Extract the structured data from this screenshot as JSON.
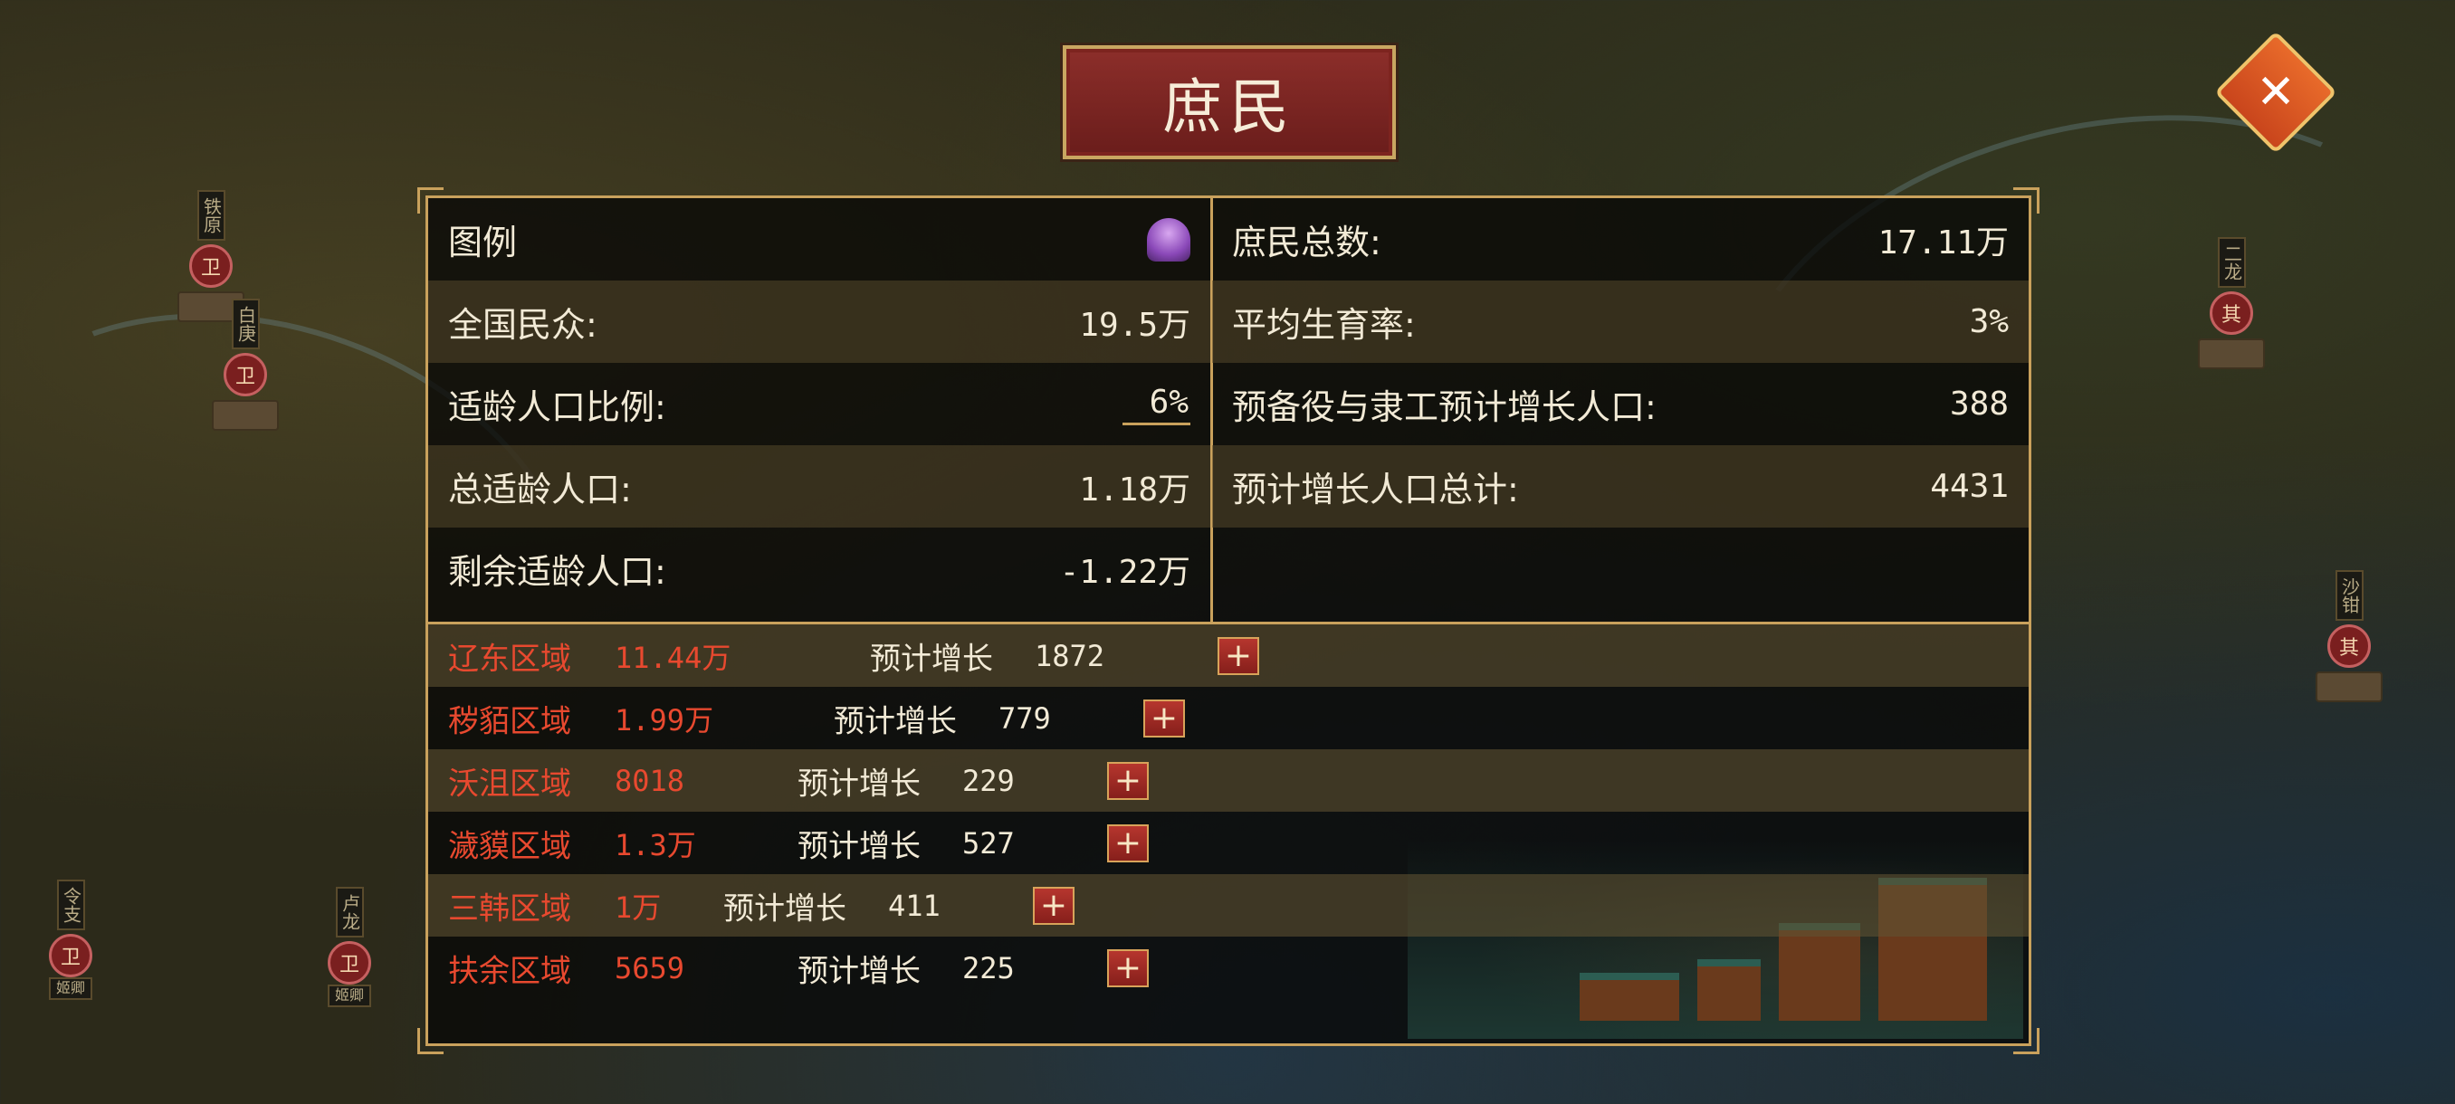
{
  "title": "庶民",
  "map_markers": [
    {
      "name": "铁原",
      "seal": "卫"
    },
    {
      "name": "白庚",
      "seal": "卫"
    },
    {
      "name": "令支",
      "seal": "卫",
      "flag": "姬卿"
    },
    {
      "name": "卢龙",
      "seal": "卫",
      "flag": "姬卿"
    },
    {
      "name": "二龙",
      "seal": "其"
    },
    {
      "name": "沙钳",
      "seal": "其"
    }
  ],
  "stats": {
    "legend_label": "图例",
    "legend_icon": "population-figures-icon",
    "national_population_label": "全国民众:",
    "national_population_value": "19.5万",
    "working_age_ratio_label": "适龄人口比例:",
    "working_age_ratio_value": "6%",
    "total_working_age_label": "总适龄人口:",
    "total_working_age_value": "1.18万",
    "remaining_working_age_label": "剩余适龄人口:",
    "remaining_working_age_value": "-1.22万",
    "commoners_total_label": "庶民总数:",
    "commoners_total_value": "17.11万",
    "avg_birth_rate_label": "平均生育率:",
    "avg_birth_rate_value": "3%",
    "reserve_growth_label": "预备役与隶工预计增长人口:",
    "reserve_growth_value": "388",
    "projected_total_label": "预计增长人口总计:",
    "projected_total_value": "4431"
  },
  "growth_label": "预计增长",
  "regions": [
    {
      "name": "辽东区域",
      "amount": "11.44万",
      "growth": "1872"
    },
    {
      "name": "秽貊区域",
      "amount": "1.99万",
      "growth": "779"
    },
    {
      "name": "沃沮区域",
      "amount": "8018",
      "growth": "229"
    },
    {
      "name": "濊貘区域",
      "amount": "1.3万",
      "growth": "527"
    },
    {
      "name": "三韩区域",
      "amount": "1万",
      "growth": "411"
    },
    {
      "name": "扶余区域",
      "amount": "5659",
      "growth": "225"
    }
  ],
  "plus_symbol": "+",
  "close_symbol": "✕",
  "colors": {
    "region_red": "#e8492f",
    "gold_border": "#c9a15c",
    "title_red": "#8c2e2a"
  }
}
